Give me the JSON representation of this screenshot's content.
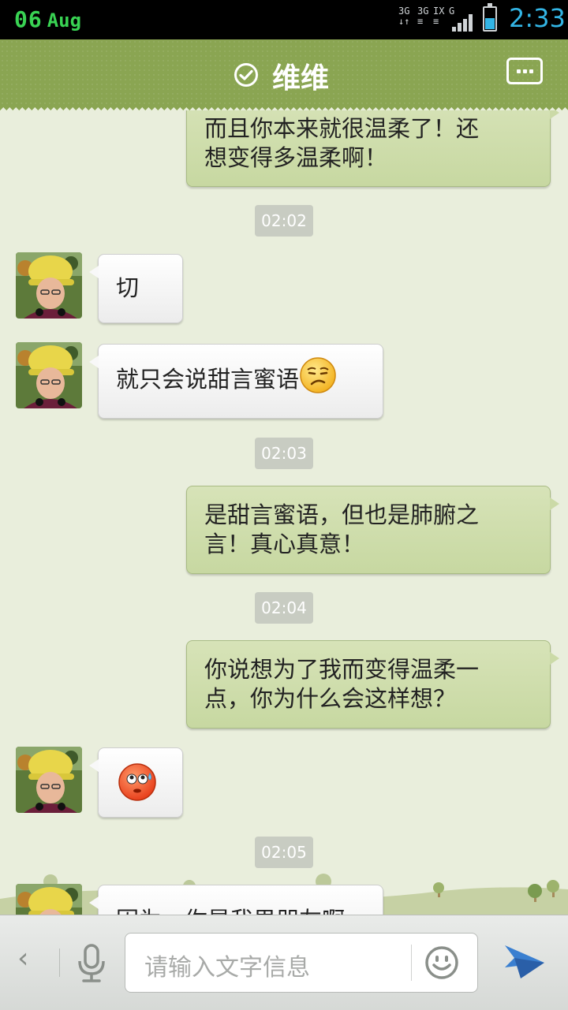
{
  "status_bar": {
    "date_day": "06",
    "date_month": "Aug",
    "net_a": "3G",
    "net_b": "3G",
    "net_c": "IX",
    "net_d": "G",
    "time": "2:33",
    "time_color": "#33b5e5"
  },
  "header": {
    "title": "维维",
    "icons": [
      "verified-check-icon",
      "more-icon"
    ]
  },
  "messages": [
    {
      "side": "right",
      "lines": [
        "而且你本来就很温柔了！还",
        "想变得多温柔啊！"
      ]
    },
    {
      "type": "timestamp",
      "text": "02:02"
    },
    {
      "side": "left",
      "text": "切"
    },
    {
      "side": "left",
      "text": "就只会说甜言蜜语",
      "emoji": "pout-emoji"
    },
    {
      "type": "timestamp",
      "text": "02:03"
    },
    {
      "side": "right",
      "lines": [
        "是甜言蜜语，但也是肺腑之",
        "言！真心真意！"
      ]
    },
    {
      "type": "timestamp",
      "text": "02:04"
    },
    {
      "side": "right",
      "lines": [
        "你说想为了我而变得温柔一",
        "点，你为什么会这样想？"
      ]
    },
    {
      "side": "left",
      "emoji": "sweat-emoji"
    },
    {
      "type": "timestamp",
      "text": "02:05"
    },
    {
      "side": "left",
      "text": "因为，你是我男朋友啊"
    }
  ],
  "input_bar": {
    "placeholder": "请输入文字信息",
    "back_glyph": "‹"
  },
  "colors": {
    "header": "#8aa552",
    "chat_bg": "#e9eedc",
    "right_bubble": "#cbdaa7",
    "timestamp_bg": "#c8ccc2"
  }
}
